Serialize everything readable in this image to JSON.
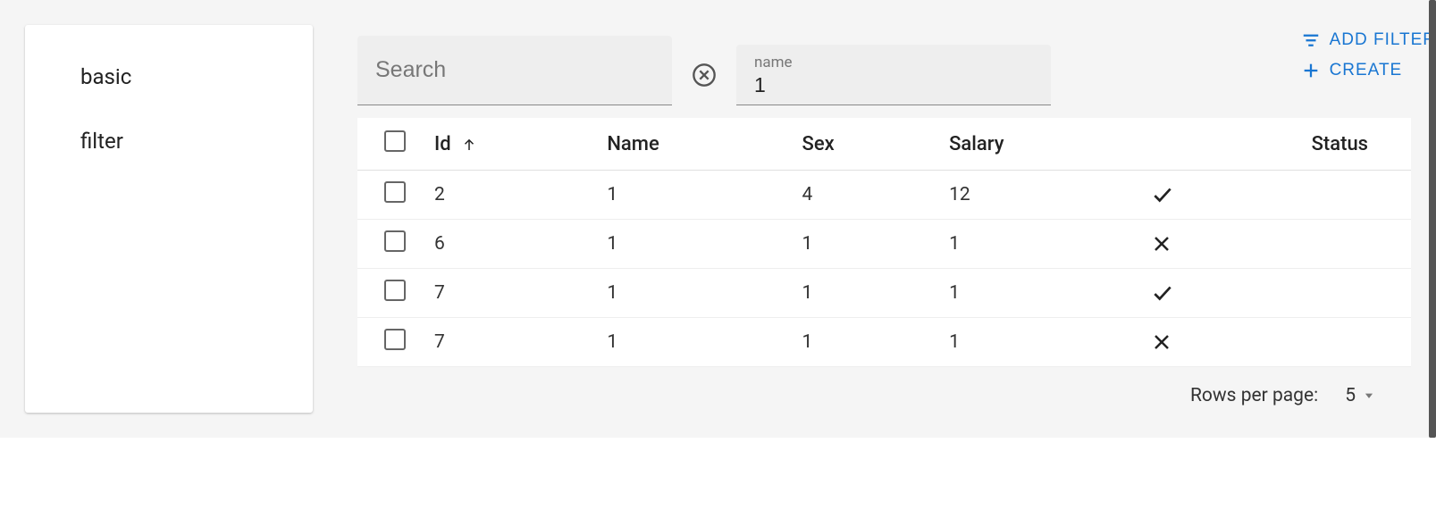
{
  "sidebar": {
    "items": [
      {
        "label": "basic"
      },
      {
        "label": "filter"
      }
    ]
  },
  "toolbar": {
    "search_placeholder": "Search",
    "filter_label": "name",
    "filter_value": "1",
    "add_filter_label": "ADD FILTER",
    "create_label": "CREATE"
  },
  "table": {
    "columns": {
      "id": "Id",
      "name": "Name",
      "sex": "Sex",
      "salary": "Salary",
      "status": "Status"
    },
    "sort_column": "id",
    "sort_direction": "asc",
    "rows": [
      {
        "id": "2",
        "name": "1",
        "sex": "4",
        "salary": "12",
        "status": true
      },
      {
        "id": "6",
        "name": "1",
        "sex": "1",
        "salary": "1",
        "status": false
      },
      {
        "id": "7",
        "name": "1",
        "sex": "1",
        "salary": "1",
        "status": true
      },
      {
        "id": "7",
        "name": "1",
        "sex": "1",
        "salary": "1",
        "status": false
      }
    ]
  },
  "pagination": {
    "rows_per_page_label": "Rows per page:",
    "rows_per_page_value": "5"
  }
}
